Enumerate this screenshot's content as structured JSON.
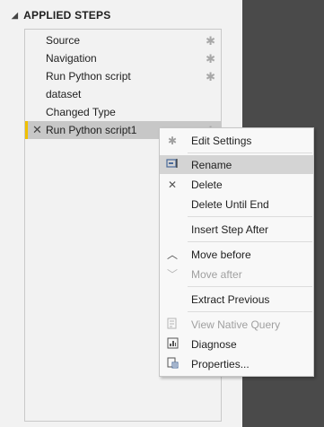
{
  "panel": {
    "title": "APPLIED STEPS"
  },
  "steps": [
    {
      "label": "Source"
    },
    {
      "label": "Navigation"
    },
    {
      "label": "Run Python script"
    },
    {
      "label": "dataset"
    },
    {
      "label": "Changed Type"
    },
    {
      "label": "Run Python script1"
    }
  ],
  "menu": {
    "edit_settings": "Edit Settings",
    "rename": "Rename",
    "delete": "Delete",
    "delete_until_end": "Delete Until End",
    "insert_step_after": "Insert Step After",
    "move_before": "Move before",
    "move_after": "Move after",
    "extract_previous": "Extract Previous",
    "view_native_query": "View Native Query",
    "diagnose": "Diagnose",
    "properties": "Properties..."
  },
  "colors": {
    "selected_accent": "#f0c000",
    "dark_panel": "#4a4a4a"
  }
}
